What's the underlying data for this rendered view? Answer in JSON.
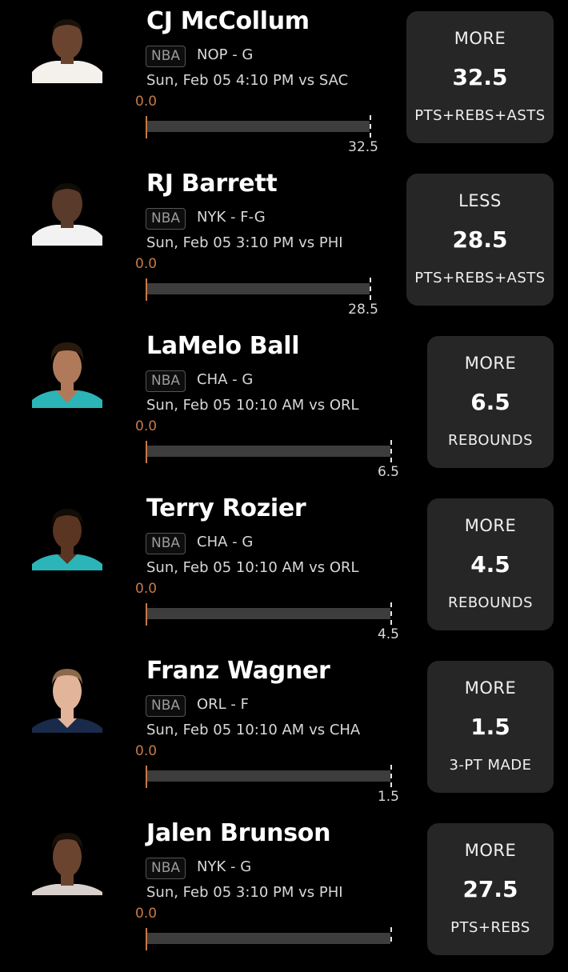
{
  "picks": [
    {
      "name": "CJ McCollum",
      "league": "NBA",
      "team_pos": "NOP - G",
      "game": "Sun, Feb 05 4:10 PM  vs SAC",
      "current": "0.0",
      "target": "32.5",
      "direction": "MORE",
      "line": "32.5",
      "stat": "PTS+REBS+ASTS",
      "progress_fraction": 0,
      "jersey_color": "#f4f1ec",
      "skin_color": "#6b4430"
    },
    {
      "name": "RJ Barrett",
      "league": "NBA",
      "team_pos": "NYK - F-G",
      "game": "Sun, Feb 05 3:10 PM  vs PHI",
      "current": "0.0",
      "target": "28.5",
      "direction": "LESS",
      "line": "28.5",
      "stat": "PTS+REBS+ASTS",
      "progress_fraction": 0,
      "jersey_color": "#f2f2f2",
      "skin_color": "#5a3a2a"
    },
    {
      "name": "LaMelo Ball",
      "league": "NBA",
      "team_pos": "CHA - G",
      "game": "Sun, Feb 05 10:10 AM  vs ORL",
      "current": "0.0",
      "target": "6.5",
      "direction": "MORE",
      "line": "6.5",
      "stat": "REBOUNDS",
      "progress_fraction": 0,
      "jersey_color": "#2bb5b8",
      "skin_color": "#b07a5a"
    },
    {
      "name": "Terry Rozier",
      "league": "NBA",
      "team_pos": "CHA - G",
      "game": "Sun, Feb 05 10:10 AM  vs ORL",
      "current": "0.0",
      "target": "4.5",
      "direction": "MORE",
      "line": "4.5",
      "stat": "REBOUNDS",
      "progress_fraction": 0,
      "jersey_color": "#2bb5b8",
      "skin_color": "#5a3522"
    },
    {
      "name": "Franz Wagner",
      "league": "NBA",
      "team_pos": "ORL - F",
      "game": "Sun, Feb 05 10:10 AM  vs CHA",
      "current": "0.0",
      "target": "1.5",
      "direction": "MORE",
      "line": "1.5",
      "stat": "3-PT MADE",
      "progress_fraction": 0,
      "jersey_color": "#1a2a4a",
      "skin_color": "#e2b49a"
    },
    {
      "name": "Jalen Brunson",
      "league": "NBA",
      "team_pos": "NYK - G",
      "game": "Sun, Feb 05 3:10 PM  vs PHI",
      "current": "0.0",
      "target": "27.5",
      "direction": "MORE",
      "line": "27.5",
      "stat": "PTS+REBS",
      "progress_fraction": 0,
      "jersey_color": "#d8d0cc",
      "skin_color": "#6b4430"
    }
  ]
}
